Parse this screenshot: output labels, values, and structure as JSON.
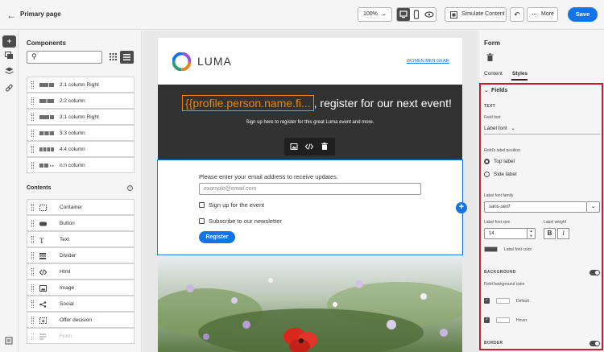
{
  "header": {
    "page_title": "Primary page",
    "zoom": "100%",
    "simulate_label": "Simulate Content",
    "more_label": "More",
    "save_label": "Save"
  },
  "components_panel": {
    "title": "Components",
    "search_placeholder": "",
    "structures": [
      {
        "label": "2:1 column Right"
      },
      {
        "label": "2:2 column"
      },
      {
        "label": "3:1 column Right"
      },
      {
        "label": "3:3 column"
      },
      {
        "label": "4:4 column"
      },
      {
        "label": "n:n column"
      }
    ],
    "contents_title": "Contents",
    "contents": [
      {
        "label": "Container",
        "icon": "container-icon"
      },
      {
        "label": "Button",
        "icon": "button-icon"
      },
      {
        "label": "Text",
        "icon": "text-icon"
      },
      {
        "label": "Divider",
        "icon": "divider-icon"
      },
      {
        "label": "Html",
        "icon": "code-icon"
      },
      {
        "label": "Image",
        "icon": "image-icon"
      },
      {
        "label": "Social",
        "icon": "share-icon"
      },
      {
        "label": "Offer decision",
        "icon": "offer-icon"
      },
      {
        "label": "Form",
        "icon": "form-icon",
        "disabled": true
      }
    ]
  },
  "email": {
    "logo_text": "LUMA",
    "nav": [
      "WOMEN",
      "MEN",
      "GEAR"
    ],
    "hero_token": "{{profile.person.name.fi...",
    "hero_text": ", register for our next event!",
    "hero_sub": "Sign up here to register for this great Luma event and more.",
    "form_prompt": "Please enter your email address to receive updates.",
    "email_placeholder": "example@email.com",
    "checkbox_1": "Sign up for the event",
    "checkbox_2": "Subscribe to our newsletter",
    "register_label": "Register"
  },
  "form_panel": {
    "title": "Form",
    "tabs": [
      {
        "label": "Content"
      },
      {
        "label": "Styles"
      }
    ],
    "active_tab": "Styles",
    "fields_header": "Fields",
    "text_section": "TEXT",
    "field_font_label": "Field font",
    "field_font_value": "Label font",
    "label_position_label": "Field's label position",
    "position_options": [
      "Top label",
      "Side label"
    ],
    "position_selected": "Top label",
    "font_family_label": "Label font family",
    "font_family_value": "sans-serif",
    "font_size_label": "Label font size",
    "font_size_value": "14",
    "weight_label": "Label weight",
    "bold_glyph": "B",
    "italic_glyph": "I",
    "label_color_label": "Label font color",
    "label_color": "#4b4b4b",
    "background_section": "BACKGROUND",
    "bg_color_label": "Field background color",
    "bg_default_label": "Default",
    "bg_hover_label": "Hover",
    "border_section": "BORDER"
  },
  "colors": {
    "accent": "#1473e6",
    "highlight": "#c4202b",
    "token": "#e68619"
  }
}
